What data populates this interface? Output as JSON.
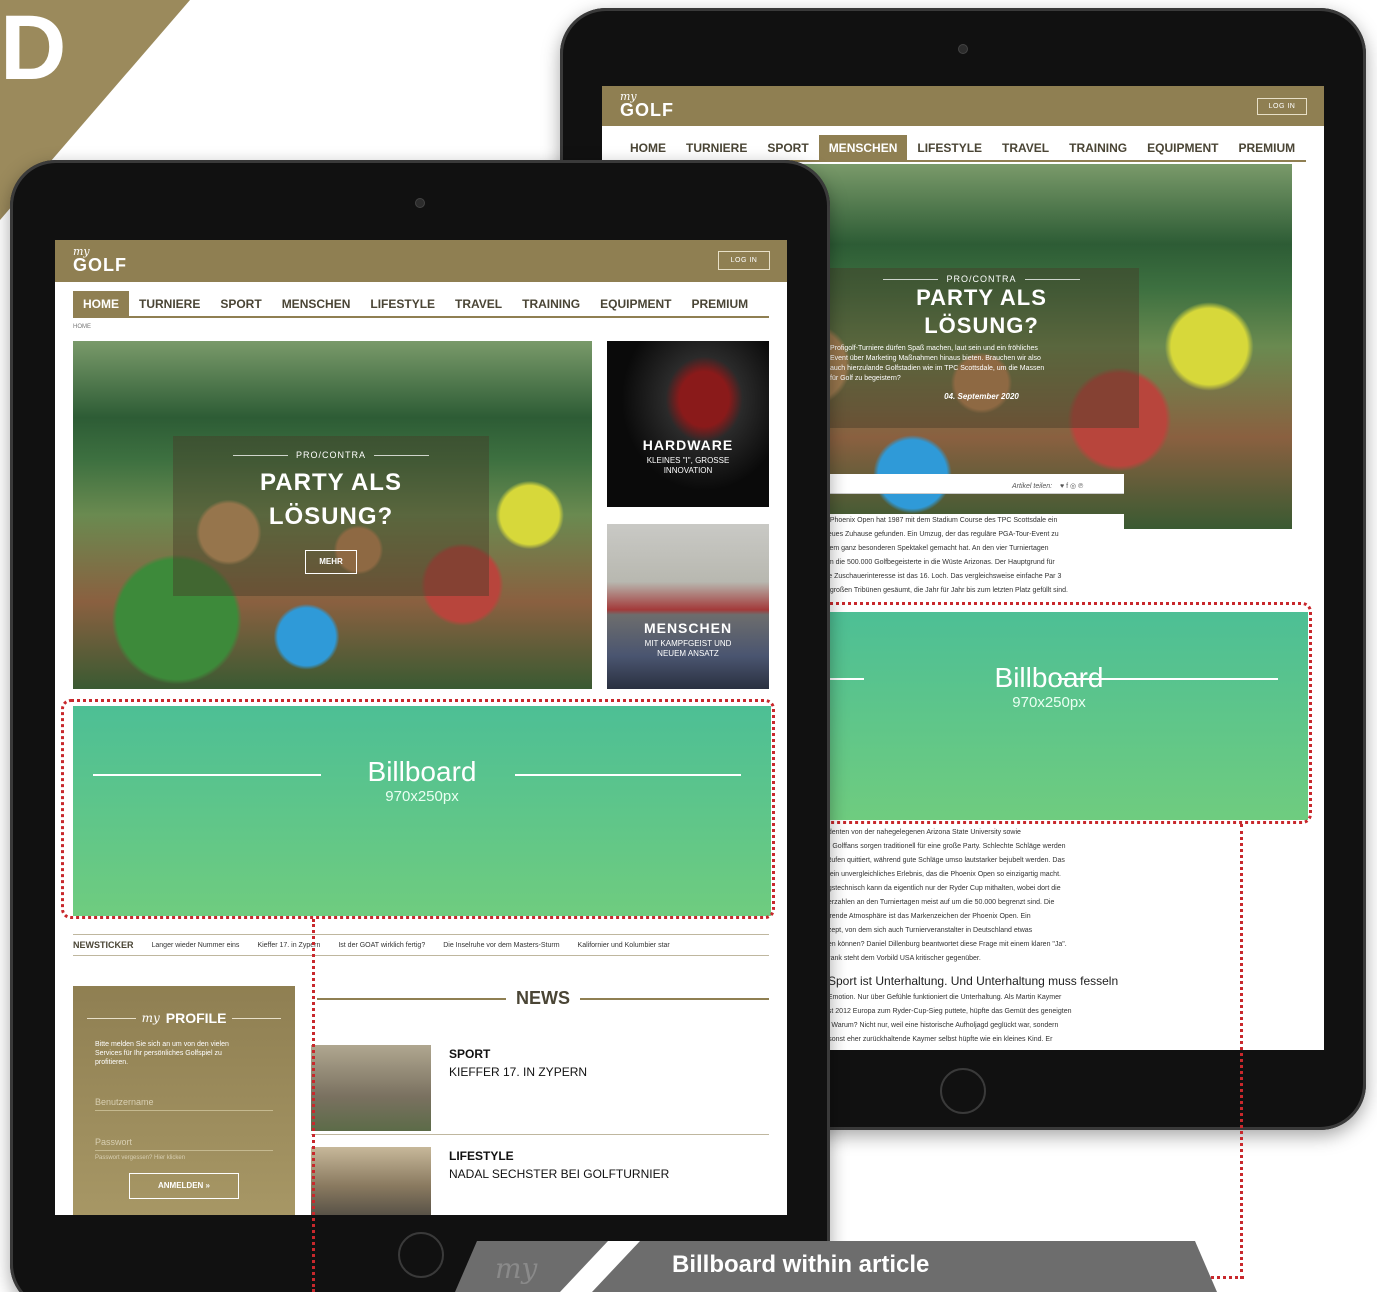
{
  "corner_letter": "D",
  "caption": {
    "text": "Billboard within article",
    "scribble": "my"
  },
  "site": {
    "logo_my": "my",
    "logo_golf": "GOLF",
    "login": "LOG IN",
    "nav": [
      "HOME",
      "TURNIERE",
      "SPORT",
      "MENSCHEN",
      "LIFESTYLE",
      "TRAVEL",
      "TRAINING",
      "EQUIPMENT",
      "PREMIUM"
    ]
  },
  "front": {
    "breadcrumb": "HOME",
    "hero": {
      "kicker": "PRO/CONTRA",
      "title_l1": "PARTY ALS",
      "title_l2": "LÖSUNG?",
      "button": "MEHR"
    },
    "card1": {
      "title": "HARDWARE",
      "sub_l1": "KLEINES \"I\", GROSSE",
      "sub_l2": "INNOVATION"
    },
    "card2": {
      "title": "MENSCHEN",
      "sub_l1": "MIT KAMPFGEIST UND",
      "sub_l2": "NEUEM ANSATZ"
    },
    "billboard": {
      "title": "Billboard",
      "size": "970x250px"
    },
    "ticker": {
      "label": "NEWSTICKER",
      "items": [
        "Langer wieder Nummer eins",
        "Kieffer 17. in Zypern",
        "Ist der GOAT wirklich fertig?",
        "Die Inselruhe vor dem Masters-Sturm",
        "Kalifornier und Kolumbier star"
      ]
    },
    "profile": {
      "heading_my": "my",
      "heading": "PROFILE",
      "desc_l1": "Bitte melden Sie sich an um von den vielen",
      "desc_l2": "Services für Ihr persönliches Golfspiel zu",
      "desc_l3": "profitieren.",
      "username": "Benutzername",
      "password": "Passwort",
      "forgot": "Passwort vergessen? Hier klicken",
      "button": "ANMELDEN »"
    },
    "news": {
      "heading": "NEWS",
      "items": [
        {
          "category": "SPORT",
          "title": "KIEFFER 17. IN ZYPERN"
        },
        {
          "category": "LIFESTYLE",
          "title": "NADAL SECHSTER BEI GOLFTURNIER"
        }
      ]
    }
  },
  "back": {
    "hero": {
      "kicker": "PRO/CONTRA",
      "title_l1": "PARTY ALS",
      "title_l2": "LÖSUNG?",
      "teaser": [
        "Profigolf-Turniere dürfen Spaß machen, laut sein und ein fröhliches",
        "Event über Marketing Maßnahmen hinaus bieten. Brauchen wir also",
        "auch hierzulande Golfstadien wie im TPC Scottsdale, um die Massen",
        "für Golf zu begeistern?"
      ],
      "date": "04. September 2020"
    },
    "share_label": "Artikel teilen:",
    "share_icons": "♥  f  ◎  ℗",
    "para1": [
      "e Phoenix Open hat 1987 mit dem Stadium Course des TPC Scottsdale ein",
      "neues Zuhause gefunden. Ein Umzug, der das reguläre PGA-Tour-Event zu",
      "inem ganz besonderen Spektakel gemacht hat. An den vier Turniertagen",
      "um die 500.000 Golfbegeisterte in die Wüste Arizonas. Der Hauptgrund für",
      "ße Zuschauerinteresse ist das 16. Loch. Das vergleichsweise einfache Par 3",
      "n großen Tribünen gesäumt, die Jahr für Jahr bis zum letzten Platz gefüllt sind."
    ],
    "billboard": {
      "title": "Billboard",
      "size": "970x250px"
    },
    "para2": [
      "udenten von der nahegelegenen Arizona State University sowie",
      "e\" Golffans sorgen traditionell für eine große Party. Schlechte Schläge werden",
      "-Rufen quittiert, während gute Schläge umso lautstarker bejubelt werden. Das",
      "t: ein unvergleichliches Erlebnis, das die Phoenix Open so einzigartig macht.",
      "ngstechnisch kann da eigentlich nur der Ryder Cup mithalten, wobei dort die",
      "uerzahlen an den Turniertagen meist auf um die 50.000 begrenzt sind. Die",
      "ierende Atmosphäre ist das Markenzeichen der Phoenix Open. Ein",
      "ezept, von dem sich auch Turnierveranstalter in Deutschland etwas",
      "uen können? Daniel Dillenburg beantwortet diese Frage mit einem klaren \"Ja\".",
      "Frank steht dem Vorbild USA kritischer gegenüber."
    ],
    "subhead": "Sport ist Unterhaltung. Und Unterhaltung muss fesseln",
    "para3": [
      "t Emotion. Nur über Gefühle funktioniert die Unterhaltung. Als Martin Kaymer",
      "bst 2012 Europa zum Ryder-Cup-Sieg puttete, hüpfte das Gemüt des geneigten",
      "s. Warum? Nicht nur, weil eine historische Aufholjagd geglückt war, sondern",
      "r sonst eher zurückhaltende Kaymer selbst hüpfte wie ein kleines Kind. Er"
    ]
  }
}
